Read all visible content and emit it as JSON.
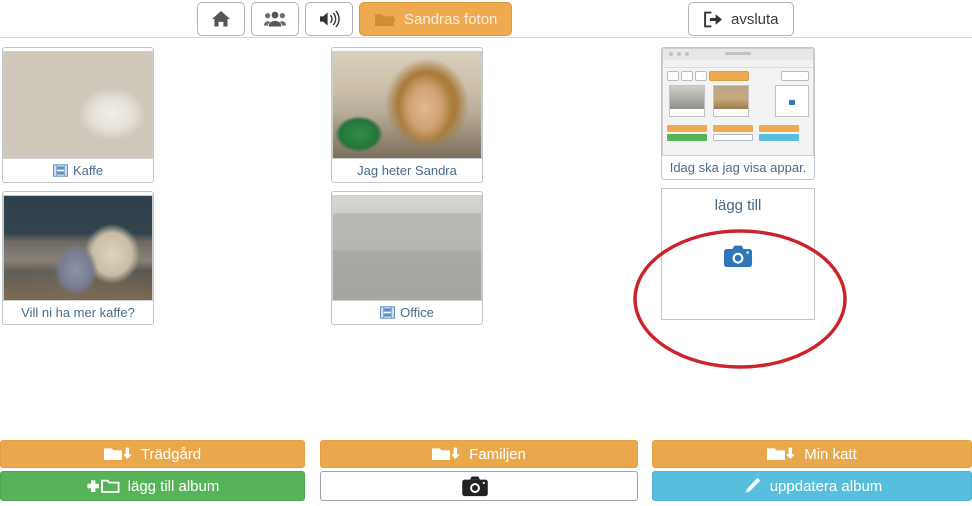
{
  "app": {
    "title": "Sandras foton",
    "language": "sv"
  },
  "colors": {
    "accent_orange": "#eaa84d",
    "green": "#56b35a",
    "blue": "#58bede",
    "caption_blue": "#4a6a8a",
    "annotation_red": "#cc2229",
    "camera_blue": "#2f77b8"
  },
  "toolbar": {
    "buttons": [
      {
        "name": "home",
        "icon": "home-icon",
        "label": "",
        "active": false
      },
      {
        "name": "users",
        "icon": "users-icon",
        "label": "",
        "active": false
      },
      {
        "name": "sound",
        "icon": "speaker-icon",
        "label": "",
        "active": false
      },
      {
        "name": "current-album",
        "icon": "folder-open-icon",
        "label": "Sandras foton",
        "active": true
      }
    ],
    "exit": {
      "name": "exit",
      "icon": "exit-icon",
      "label": "avsluta"
    }
  },
  "photos": {
    "columns": [
      {
        "id": "col-1",
        "cards": [
          {
            "caption": "Kaffe",
            "has_video": true,
            "image": "coffee-cup-on-table"
          },
          {
            "caption": "Vill ni ha mer kaffe?",
            "has_video": false,
            "image": "coffee-station-with-cups"
          }
        ]
      },
      {
        "id": "col-2",
        "cards": [
          {
            "caption": "Jag heter Sandra",
            "has_video": false,
            "image": "woman-in-office"
          },
          {
            "caption": "Office",
            "has_video": true,
            "image": "filing-cabinets-in-office"
          }
        ]
      },
      {
        "id": "col-3",
        "cards": [
          {
            "caption": "Idag ska jag visa appar.",
            "has_video": false,
            "image": "screenshot-of-photo-app"
          }
        ],
        "add_card": {
          "title": "lägg till",
          "icon": "camera-icon"
        }
      }
    ]
  },
  "albums": [
    {
      "album_label": "Trädgård",
      "album_icon": "folder-download-icon",
      "action_label": "lägg till album",
      "action_icon": "plus-folder-icon",
      "action_style": "green"
    },
    {
      "album_label": "Familjen",
      "album_icon": "folder-download-icon",
      "action_label": "",
      "action_icon": "camera-icon",
      "action_style": "white"
    },
    {
      "album_label": "Min katt",
      "album_icon": "folder-download-icon",
      "action_label": "uppdatera album",
      "action_icon": "pencil-icon",
      "action_style": "blue"
    }
  ],
  "annotation": {
    "shape": "ellipse",
    "color": "#cc2229",
    "target": "lägg till"
  }
}
